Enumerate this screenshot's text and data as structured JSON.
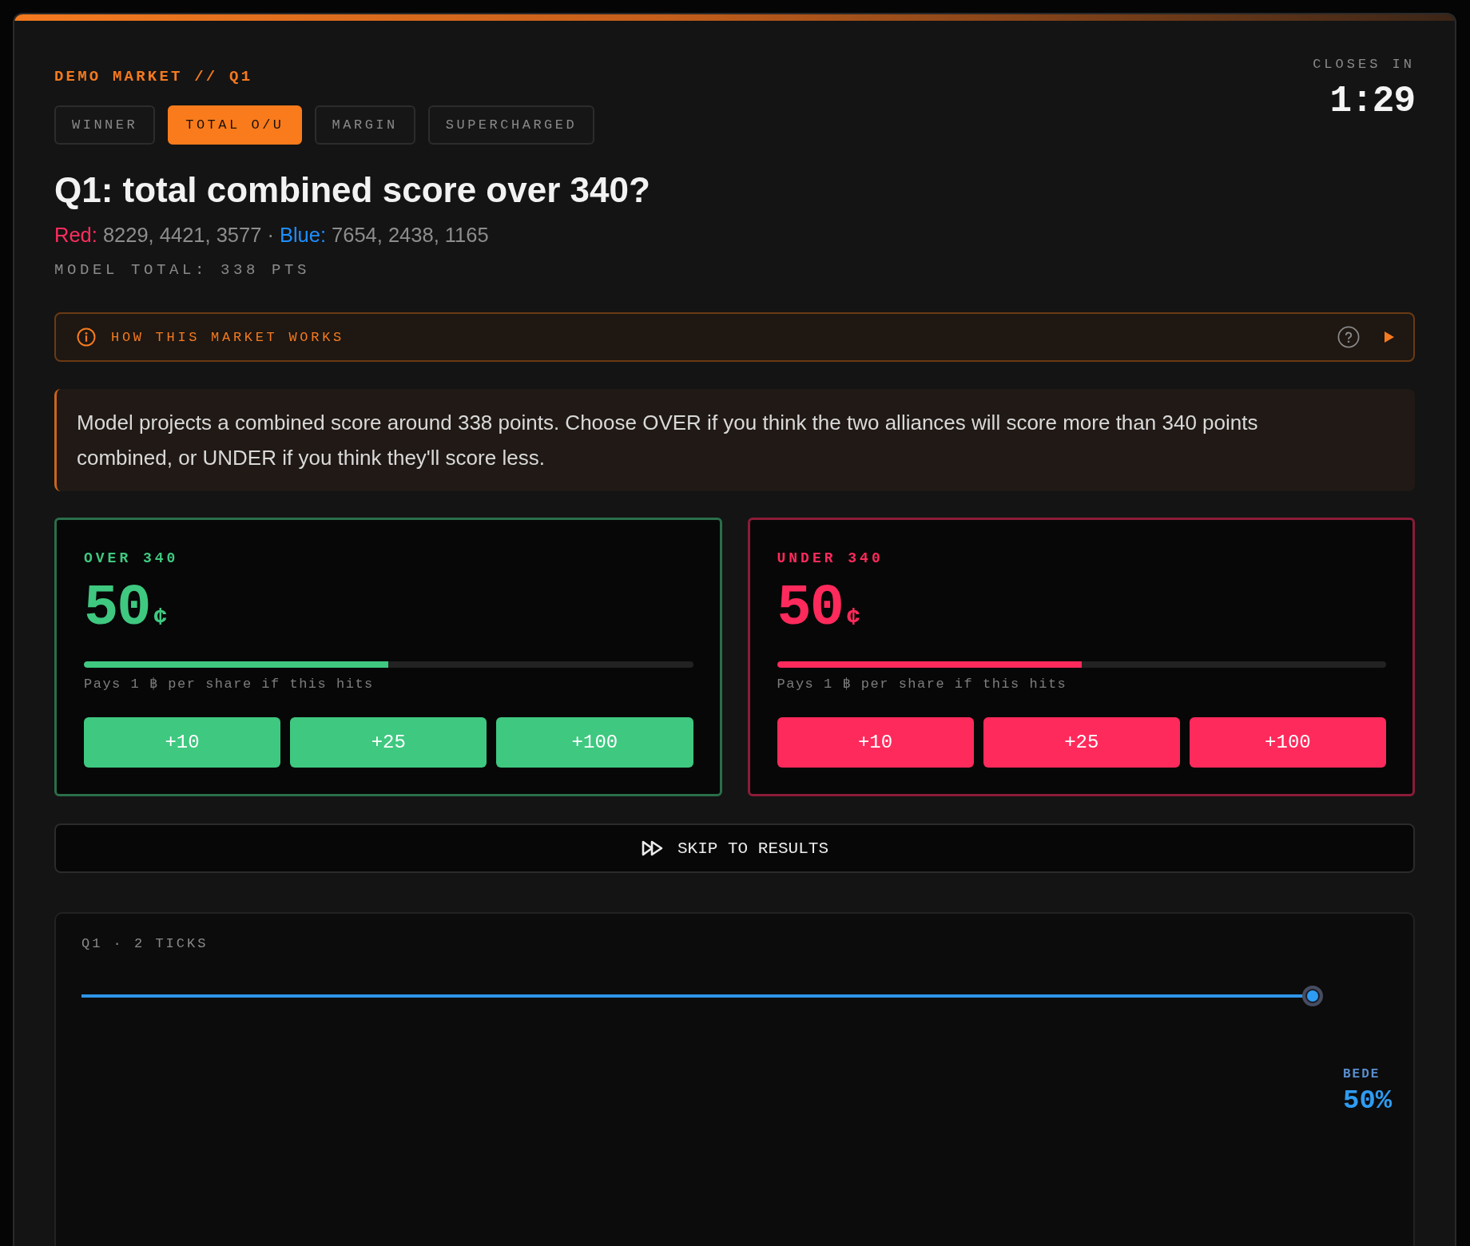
{
  "header": {
    "eyebrow": "DEMO MARKET // Q1",
    "countdown_label": "CLOSES IN",
    "countdown": "1:29"
  },
  "tabs": [
    {
      "label": "WINNER",
      "selected": false
    },
    {
      "label": "TOTAL O/U",
      "selected": true
    },
    {
      "label": "MARGIN",
      "selected": false
    },
    {
      "label": "SUPERCHARGED",
      "selected": false
    }
  ],
  "question": {
    "title": "Q1: total combined score over 340?",
    "teams": [
      {
        "label": "Red:",
        "numbers": "8229, 4421, 3577",
        "color": "#ff2d5f"
      },
      {
        "label": "Blue:",
        "numbers": "7654, 2438, 1165",
        "color": "#1e8fff"
      }
    ],
    "separator": "·",
    "model_total": "MODEL TOTAL: 338 PTS"
  },
  "info_bar": {
    "title": "HOW THIS MARKET WORKS",
    "expanded": false
  },
  "description": "Model projects a combined score around 338 points. Choose OVER if you think the two alliances will score more than 340 points combined, or UNDER if you think they'll score less.",
  "outcomes": [
    {
      "kind": "over",
      "label": "OVER 340",
      "price": "50",
      "unit": "¢",
      "level": 0.5,
      "note": "Pays 1 ฿ per share if this hits",
      "amounts": [
        "+10",
        "+25",
        "+100"
      ]
    },
    {
      "kind": "under",
      "label": "UNDER 340",
      "price": "50",
      "unit": "¢",
      "level": 0.5,
      "note": "Pays 1 ฿ per share if this hits",
      "amounts": [
        "+10",
        "+25",
        "+100"
      ]
    }
  ],
  "skip_button": {
    "label": "SKIP TO RESULTS"
  },
  "chart": {
    "title": "Q1 · 2 TICKS",
    "series_label": "BEDE",
    "value": "50%"
  }
}
